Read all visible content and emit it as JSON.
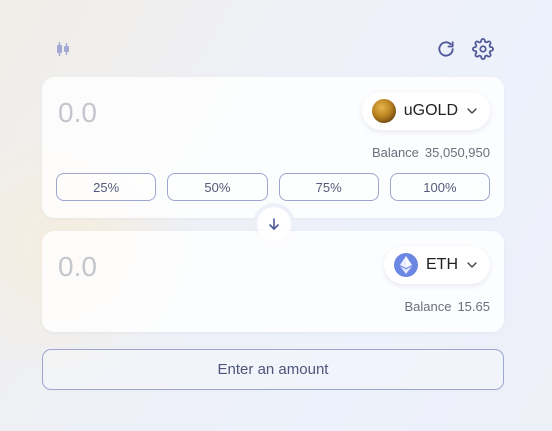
{
  "header": {
    "chart_icon": "candlestick-chart-icon",
    "refresh_icon": "refresh-icon",
    "settings_icon": "gear-icon"
  },
  "from": {
    "amount_placeholder": "0.0",
    "token": {
      "symbol": "uGOLD",
      "icon": "gold-coin-icon"
    },
    "balance_label": "Balance",
    "balance_value": "35,050,950",
    "percent_buttons": [
      "25%",
      "50%",
      "75%",
      "100%"
    ]
  },
  "switch_icon": "arrow-down-icon",
  "to": {
    "amount_placeholder": "0.0",
    "token": {
      "symbol": "ETH",
      "icon": "ethereum-icon"
    },
    "balance_label": "Balance",
    "balance_value": "15.65"
  },
  "action_button": {
    "label": "Enter an amount"
  },
  "colors": {
    "accent_border": "#9ea6cf",
    "text_muted": "#6b6f7b",
    "icon_color": "#4f5898",
    "eth_blue": "#6b86e3"
  }
}
